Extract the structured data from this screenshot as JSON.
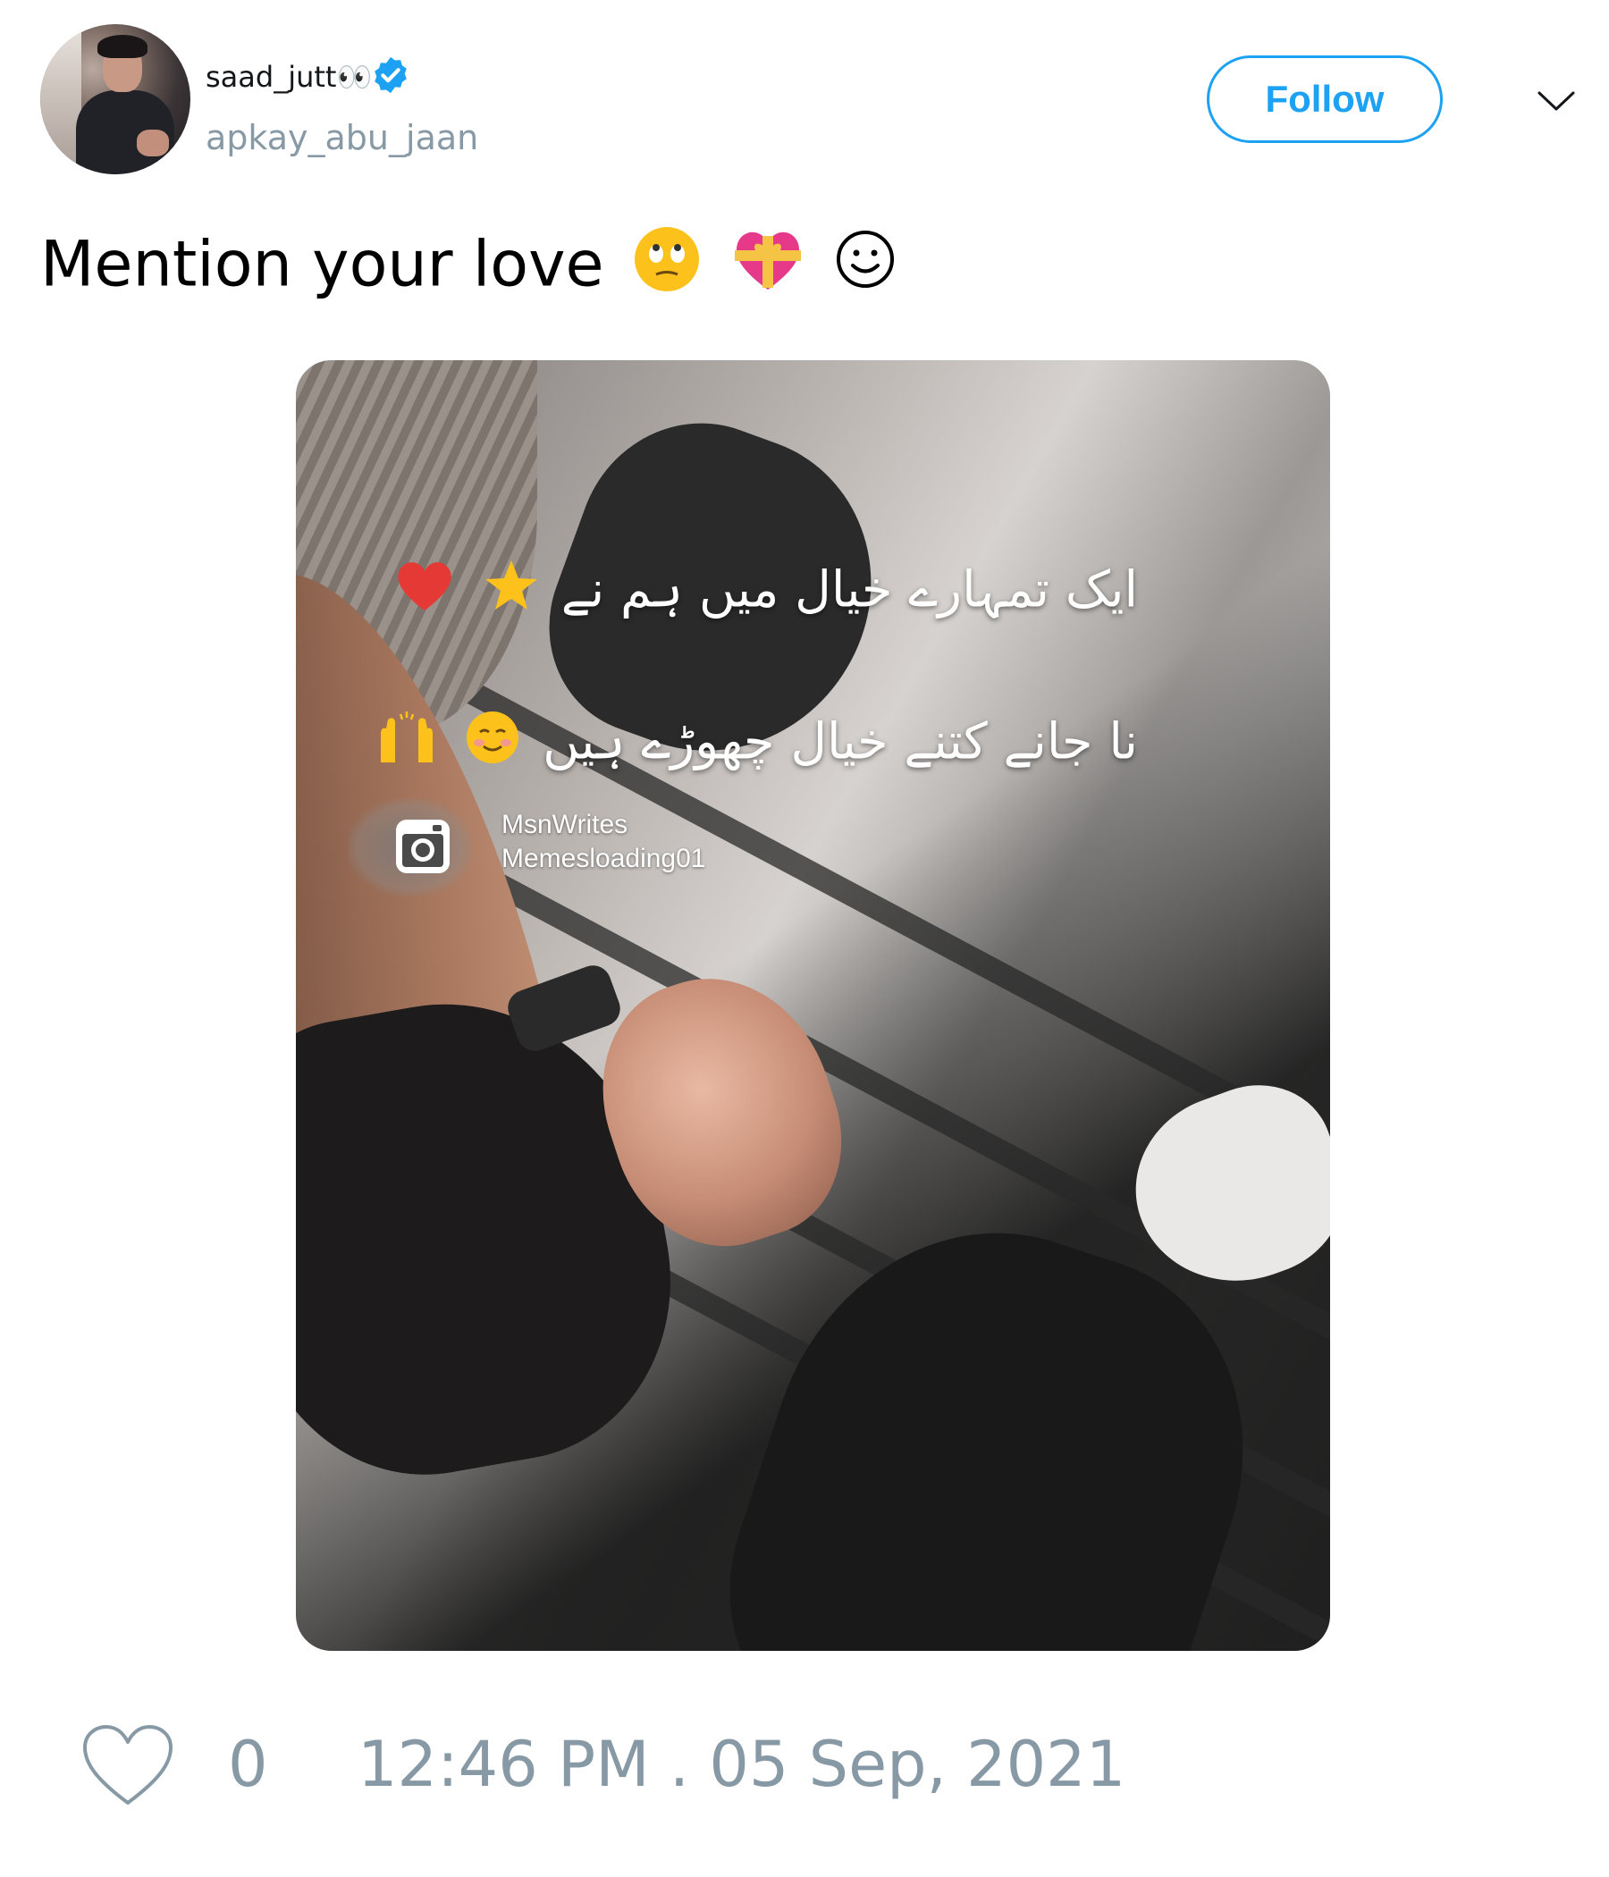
{
  "user": {
    "display_name": "saad_jutt👀",
    "handle": "apkay_abu_jaan",
    "verified": true,
    "verified_color": "#1da1f2"
  },
  "follow_button": {
    "label": "Follow",
    "color": "#1da1f2"
  },
  "menu": {
    "icon": "chevron-down-icon"
  },
  "tweet": {
    "text": "Mention your love",
    "emojis": [
      "🙄",
      "💝",
      "☺"
    ]
  },
  "media": {
    "urdu_line_1": "ایک تمہارے خیال میں ہم نے",
    "urdu_line_1_emojis": [
      "🌟",
      "❤️"
    ],
    "urdu_line_2": "نا جانے کتنے خیال چھوڑے ہیں",
    "urdu_line_2_emojis": [
      "☺️",
      "🙌"
    ],
    "watermark_icon": "instagram-icon",
    "watermark_line_1": "MsnWrites",
    "watermark_line_2": "Memesloading01"
  },
  "footer": {
    "like_icon": "heart-icon",
    "like_count": "0",
    "timestamp": "12:46 PM . 05 Sep, 2021",
    "muted_color": "#8899a6"
  }
}
